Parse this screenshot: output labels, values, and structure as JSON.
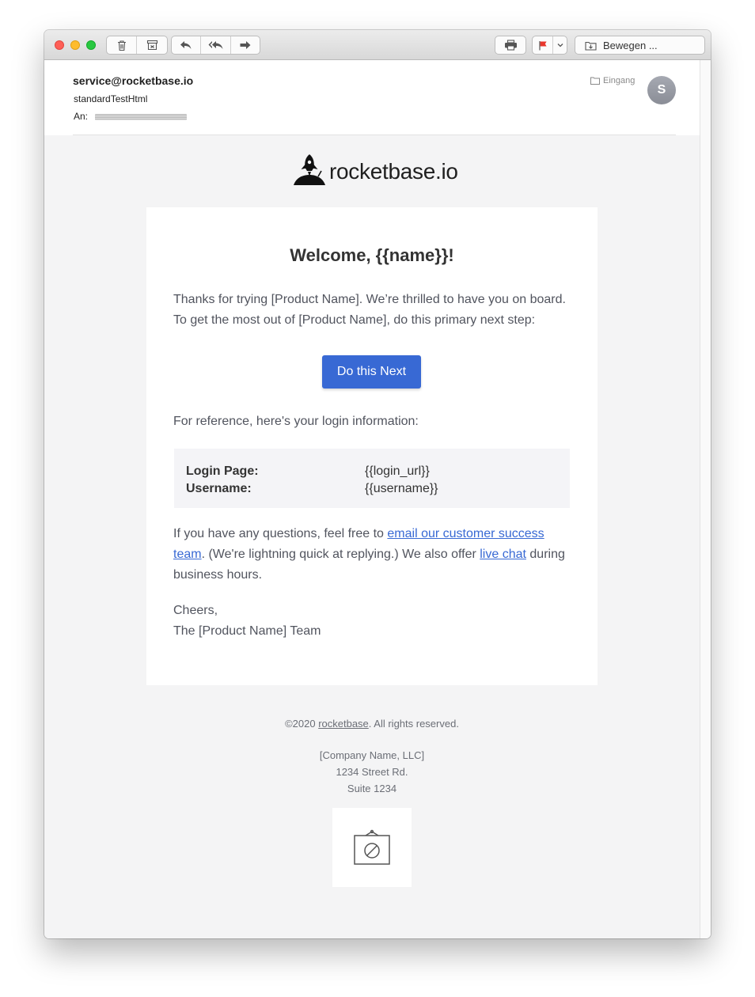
{
  "toolbar": {
    "move_label": "Bewegen ...",
    "flag_color": "#e8372c",
    "icons": [
      "trash-icon",
      "archive-icon",
      "reply-icon",
      "reply-all-icon",
      "forward-icon",
      "print-icon",
      "flag-icon",
      "chevron-down-icon",
      "move-to-folder-icon"
    ]
  },
  "message": {
    "from": "service@rocketbase.io",
    "subject": "standardTestHtml",
    "to_label": "An:",
    "folder": "Eingang",
    "avatar_initial": "S"
  },
  "email": {
    "logo_text": "rocketbase.io",
    "heading": "Welcome, {{name}}!",
    "intro": "Thanks for trying [Product Name]. We’re thrilled to have you on board. To get the most out of [Product Name], do this primary next step:",
    "cta_label": "Do this Next",
    "reference_text": "For reference, here's your login information:",
    "login": {
      "login_page_label": "Login Page:",
      "login_page_value": "{{login_url}}",
      "username_label": "Username:",
      "username_value": "{{username}}"
    },
    "questions_pre": "If you have any questions, feel free to ",
    "questions_link": "email our customer success team",
    "questions_mid": ". (We're lightning quick at replying.) We also offer ",
    "chat_link": "live chat",
    "questions_post": " during business hours.",
    "signoff": "Cheers,",
    "signature": "The [Product Name] Team",
    "accent_color": "#3869d4"
  },
  "footer": {
    "copyright_pre": "©2020 ",
    "copyright_link": "rocketbase",
    "copyright_post": ". All rights reserved.",
    "company": "[Company Name, LLC]",
    "street": "1234 Street Rd.",
    "suite": "Suite 1234"
  }
}
